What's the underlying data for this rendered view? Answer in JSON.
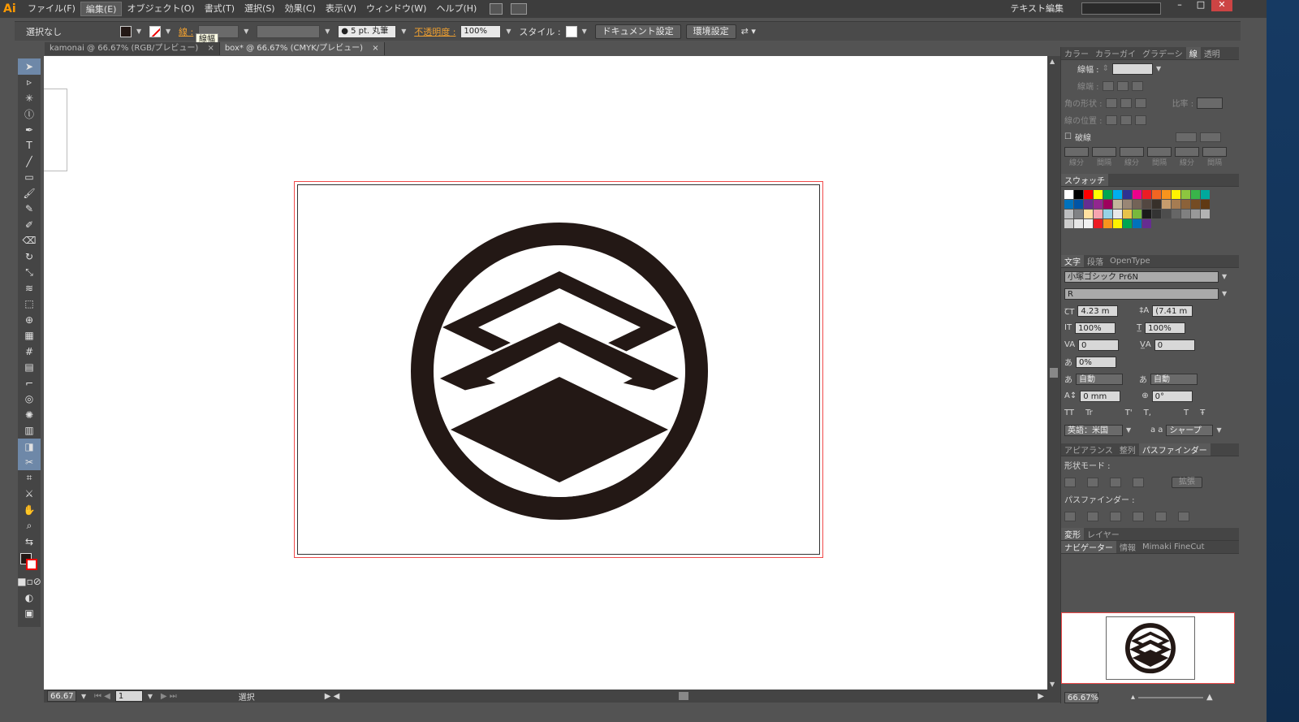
{
  "menubar": {
    "logo": "Ai",
    "items": [
      "ファイル(F)",
      "編集(E)",
      "オブジェクト(O)",
      "書式(T)",
      "選択(S)",
      "効果(C)",
      "表示(V)",
      "ウィンドウ(W)",
      "ヘルプ(H)"
    ],
    "workspace": "テキスト編集",
    "win_controls": [
      "–",
      "□",
      "✕"
    ]
  },
  "controlbar": {
    "selection": "選択なし",
    "stroke_label": "線 :",
    "brush_value": "● 5 pt. 丸筆",
    "opacity_label": "不透明度 :",
    "opacity_value": "100%",
    "style_label": "スタイル :",
    "doc_settings": "ドキュメント設定",
    "prefs": "環境設定",
    "tooltip": "線幅"
  },
  "doctabs": [
    {
      "label": "kamonai @ 66.67% (RGB/プレビュー)",
      "close": "×"
    },
    {
      "label": "box* @ 66.67% (CMYK/プレビュー)",
      "close": "×"
    }
  ],
  "status": {
    "zoom": "66.67",
    "page": "1",
    "mode": "選択"
  },
  "panels": {
    "stroke_tabs": [
      "カラー",
      "カラーガイ",
      "グラデーシ",
      "線",
      "透明"
    ],
    "stroke_width_label": "線幅 :",
    "cap_label": "線端 :",
    "corner_label": "角の形状 :",
    "ratio_label": "比率 :",
    "align_label": "線の位置 :",
    "dash_label": "破線",
    "dash_cells": [
      "線分",
      "間隔",
      "線分",
      "間隔",
      "線分",
      "間隔"
    ],
    "swatches_tab": "スウォッチ",
    "type_tabs": [
      "文字",
      "段落",
      "OpenType"
    ],
    "font_family": "小塚ゴシック Pr6N",
    "font_style": "R",
    "font_size": "4.23 m",
    "leading": "(7.41 m",
    "vscale": "100%",
    "hscale": "100%",
    "kerning": "0",
    "tracking": "0",
    "tsume": "0%",
    "aki_before": "自動",
    "aki_after": "自動",
    "baseline": "0 mm",
    "rotation": "0°",
    "case_buttons": [
      "TT",
      "Tr",
      "T'",
      "T,",
      "T",
      "Ŧ"
    ],
    "language": "英語：米国",
    "aa_label": "a a",
    "antialias": "シャープ",
    "pf_tabs": [
      "アピアランス",
      "整列",
      "パスファインダー"
    ],
    "shape_mode_label": "形状モード :",
    "expand_button": "拡張",
    "pathfinder_label": "パスファインダー :",
    "transform_tabs": [
      "変形",
      "レイヤー"
    ],
    "nav_tabs": [
      "ナビゲーター",
      "情報",
      "Mimaki FineCut"
    ],
    "nav_zoom": "66.67%"
  },
  "colors": {
    "artwork": "#231815",
    "accent": "#f0a030",
    "artboard_border": "#f04a4a",
    "swatch_rows": [
      [
        "#ffffff",
        "#000000",
        "#ff0000",
        "#ffff00",
        "#00a651",
        "#00aeef",
        "#2e3192",
        "#ec008c",
        "#ed1c24",
        "#f26522",
        "#f7941d",
        "#fff200",
        "#8dc63f",
        "#39b54a"
      ],
      [
        "#00a99d",
        "#0072bc",
        "#0054a6",
        "#662d91",
        "#92278f",
        "#9e005d",
        "#c2b59b",
        "#998675",
        "#736357",
        "#534741",
        "#37302a",
        "#c69c6d",
        "#a67c52",
        "#8c6239"
      ],
      [
        "#754c24",
        "#603913",
        "#bcbec0",
        "#808285",
        "#ffe0a0",
        "#f6a4b0",
        "#96d2e6",
        "#e8e8e8",
        "#e6c24a",
        "#78b83c",
        "#1a1a1a",
        "#333333",
        "#4d4d4d",
        "#666666"
      ],
      [
        "#808080",
        "#999999",
        "#b3b3b3",
        "#cccccc",
        "#e6e6e6",
        "#f2f2f2",
        "#ed1c24",
        "#f7941d",
        "#fff200",
        "#00a651",
        "#0072bc",
        "#662d91"
      ]
    ]
  }
}
